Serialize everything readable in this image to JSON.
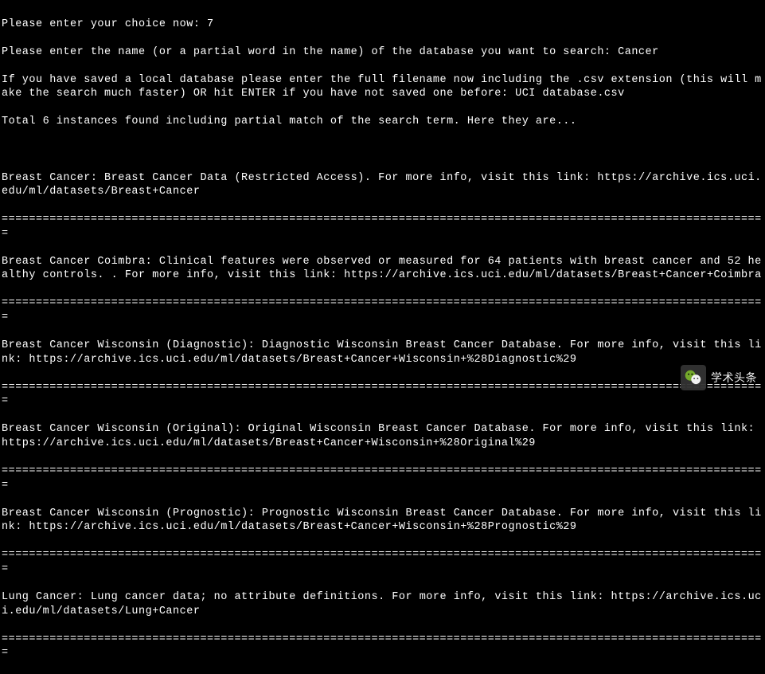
{
  "prompts": {
    "choice_prompt": "Please enter your choice now: ",
    "choice_value": "7",
    "name_prompt": "Please enter the name (or a partial word in the name) of the database you want to search: ",
    "name_value": "Cancer",
    "file_prompt": "If you have saved a local database please enter the full filename now including the .csv extension (this will make the search much faster) OR hit ENTER if you have not saved one before: ",
    "file_value": "UCI database.csv",
    "result_summary": "Total 6 instances found including partial match of the search term. Here they are..."
  },
  "separator": "================================================================================================================",
  "results": [
    {
      "title": "Breast Cancer",
      "description": "Breast Cancer Data (Restricted Access)",
      "link_intro": ". For more info, visit this link: ",
      "url": "https://archive.ics.uci.edu/ml/datasets/Breast+Cancer"
    },
    {
      "title": "Breast Cancer Coimbra",
      "description": "Clinical features were observed or measured for 64 patients with breast cancer and 52 healthy controls. ",
      "link_intro": ". For more info, visit this link: ",
      "url": "https://archive.ics.uci.edu/ml/datasets/Breast+Cancer+Coimbra"
    },
    {
      "title": "Breast Cancer Wisconsin (Diagnostic)",
      "description": "Diagnostic Wisconsin Breast Cancer Database",
      "link_intro": ". For more info, visit this link: ",
      "url": "https://archive.ics.uci.edu/ml/datasets/Breast+Cancer+Wisconsin+%28Diagnostic%29"
    },
    {
      "title": "Breast Cancer Wisconsin (Original)",
      "description": "Original Wisconsin Breast Cancer Database",
      "link_intro": ". For more info, visit this link: ",
      "url": "https://archive.ics.uci.edu/ml/datasets/Breast+Cancer+Wisconsin+%28Original%29"
    },
    {
      "title": "Breast Cancer Wisconsin (Prognostic)",
      "description": "Prognostic Wisconsin Breast Cancer Database",
      "link_intro": ". For more info, visit this link: ",
      "url": "https://archive.ics.uci.edu/ml/datasets/Breast+Cancer+Wisconsin+%28Prognostic%29"
    },
    {
      "title": "Lung Cancer",
      "description": "Lung cancer data; no attribute definitions",
      "link_intro": ". For more info, visit this link: ",
      "url": "https://archive.ics.uci.edu/ml/datasets/Lung+Cancer"
    }
  ],
  "watermark": {
    "text": "学术头条"
  }
}
